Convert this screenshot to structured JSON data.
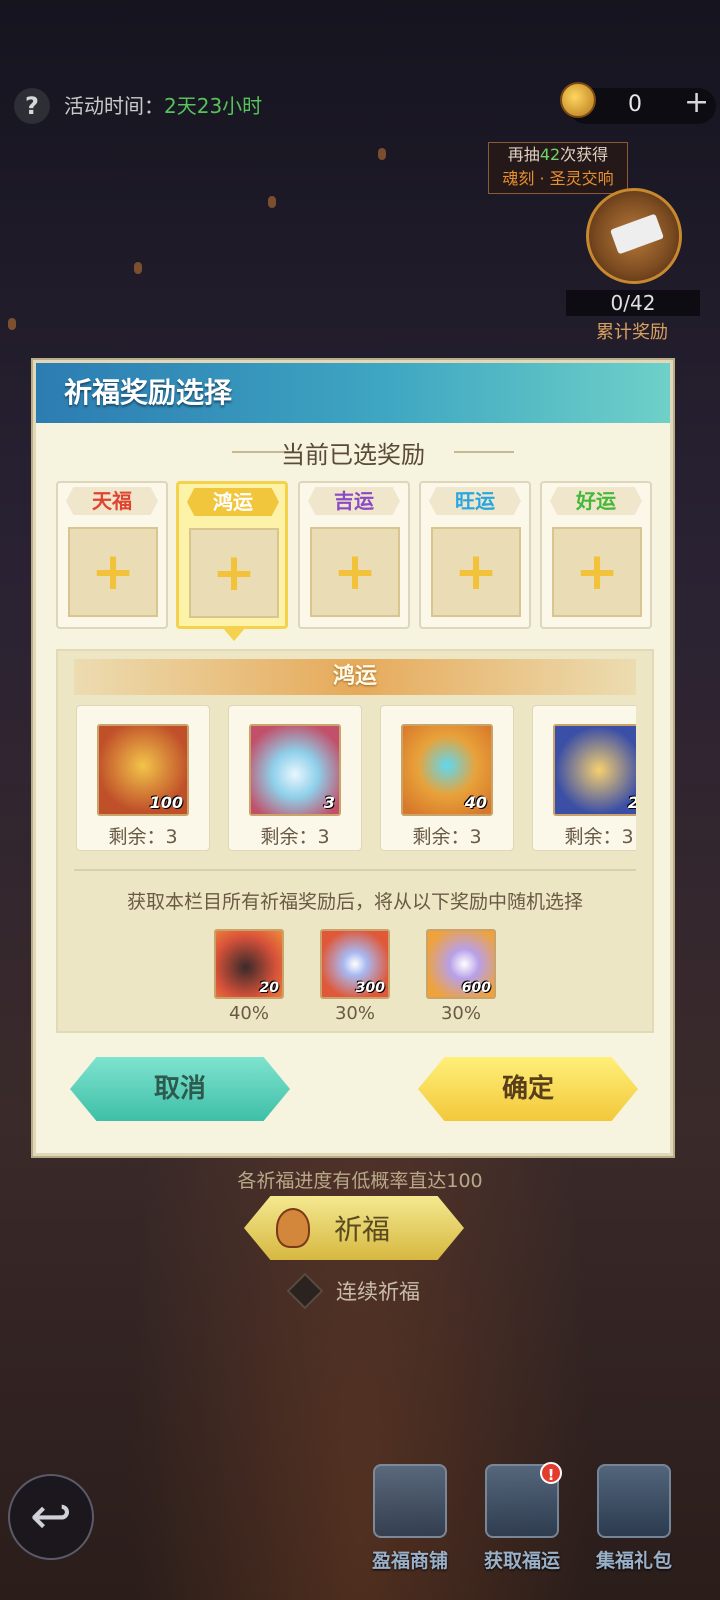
{
  "top_bar": {
    "event_time_label": "活动时间：",
    "event_time_value": "2天23小时",
    "currency_value": "0",
    "add_label": "+"
  },
  "draw_hint": {
    "prefix": "再抽",
    "count": "42",
    "suffix": "次获得",
    "reward_name": "魂刻 · 圣灵交响"
  },
  "cumulative": {
    "progress": "0/42",
    "label": "累计奖励"
  },
  "modal": {
    "title": "祈福奖励选择",
    "section_title": "当前已选奖励",
    "tiers": [
      {
        "label": "天福",
        "color": "#e0432f"
      },
      {
        "label": "鸿运",
        "color": "#ffffff"
      },
      {
        "label": "吉运",
        "color": "#8b4bc4"
      },
      {
        "label": "旺运",
        "color": "#27a6df"
      },
      {
        "label": "好运",
        "color": "#45b83a"
      }
    ],
    "plus_symbol": "+",
    "pool": {
      "title": "鸿运",
      "items": [
        {
          "qty": "100",
          "remain": "剩余：3",
          "icon": "golden-wings-icon"
        },
        {
          "qty": "3",
          "remain": "剩余：3",
          "icon": "crystal-shard-icon"
        },
        {
          "qty": "40",
          "remain": "剩余：3",
          "icon": "armillary-sphere-icon"
        },
        {
          "qty": "2",
          "remain": "剩余：3",
          "icon": "treasure-chest-icon"
        }
      ],
      "note": "获取本栏目所有祈福奖励后，将从以下奖励中随机选择",
      "bonus": [
        {
          "qty": "20",
          "pct": "40%",
          "icon": "stone-icon"
        },
        {
          "qty": "300",
          "pct": "30%",
          "icon": "star-burst-icon"
        },
        {
          "qty": "600",
          "pct": "30%",
          "icon": "blade-icon"
        }
      ]
    },
    "cancel_label": "取消",
    "confirm_label": "确定"
  },
  "below": {
    "probability_note": "各祈福进度有低概率直达100",
    "pray_label": "祈福",
    "continuous_label": "连续祈福"
  },
  "bottom_nav": [
    {
      "label": "盈福商铺",
      "icon": "shop-icon"
    },
    {
      "label": "获取福运",
      "icon": "book-icon",
      "badge": "!"
    },
    {
      "label": "集福礼包",
      "icon": "gift-icon"
    }
  ]
}
